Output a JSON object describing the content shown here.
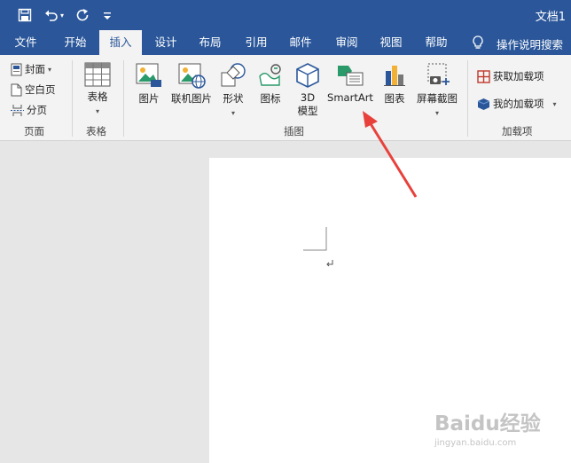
{
  "window": {
    "title": "文档1"
  },
  "quick_access": {
    "save_icon": "save-icon",
    "undo_icon": "undo-icon",
    "redo_icon": "redo-icon",
    "customize_icon": "customize-qat-icon"
  },
  "tabs": [
    {
      "label": "文件"
    },
    {
      "label": "开始"
    },
    {
      "label": "插入",
      "active": true
    },
    {
      "label": "设计"
    },
    {
      "label": "布局"
    },
    {
      "label": "引用"
    },
    {
      "label": "邮件"
    },
    {
      "label": "审阅"
    },
    {
      "label": "视图"
    },
    {
      "label": "帮助"
    }
  ],
  "tell_me": {
    "label": "操作说明搜索",
    "icon": "lightbulb-icon"
  },
  "ribbon": {
    "pages_group": {
      "label": "页面",
      "cover": "封面",
      "blank": "空白页",
      "break": "分页"
    },
    "tables_group": {
      "label": "表格",
      "table": "表格"
    },
    "illustrations_group": {
      "label": "插图",
      "picture": "图片",
      "online_picture": "联机图片",
      "shapes": "形状",
      "icons": "图标",
      "model3d_line1": "3D",
      "model3d_line2": "模型",
      "smartart": "SmartArt",
      "chart": "图表",
      "screenshot": "屏幕截图"
    },
    "addins_group": {
      "label": "加载项",
      "get_addins": "获取加载项",
      "my_addins": "我的加载项"
    }
  },
  "colors": {
    "brand": "#2b579a",
    "ribbon_bg": "#f3f3f3",
    "arrow": "#e8413c"
  },
  "watermark": {
    "text": "Baidu经验",
    "subtext": "jingyan.baidu.com"
  }
}
